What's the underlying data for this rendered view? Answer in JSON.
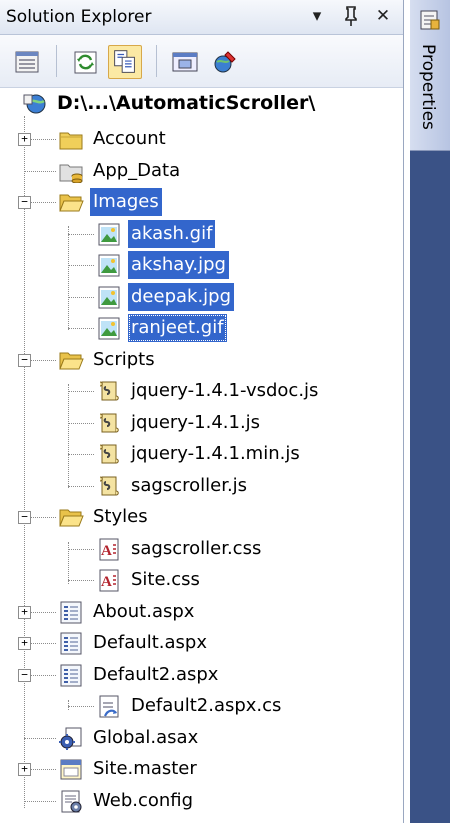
{
  "panel": {
    "title": "Solution Explorer",
    "pin": "↕",
    "close": "✕",
    "dropdown": "▾"
  },
  "side_tab": {
    "label": "Properties"
  },
  "root": {
    "label": "D:\\...\\AutomaticScroller\\"
  },
  "tree": [
    {
      "label": "Account",
      "icon": "folder-icon",
      "expander": "+"
    },
    {
      "label": "App_Data",
      "icon": "data-folder-icon",
      "expander": ""
    },
    {
      "label": "Images",
      "icon": "folder-open-icon",
      "expander": "−",
      "selected": true
    },
    {
      "label": "akash.gif",
      "icon": "image-file-icon",
      "selected": true
    },
    {
      "label": "akshay.jpg",
      "icon": "image-file-icon",
      "selected": true
    },
    {
      "label": "deepak.jpg",
      "icon": "image-file-icon",
      "selected": true
    },
    {
      "label": "ranjeet.gif",
      "icon": "image-file-icon",
      "selected": true,
      "focused": true
    },
    {
      "label": "Scripts",
      "icon": "folder-open-icon",
      "expander": "−"
    },
    {
      "label": "jquery-1.4.1-vsdoc.js",
      "icon": "script-file-icon"
    },
    {
      "label": "jquery-1.4.1.js",
      "icon": "script-file-icon"
    },
    {
      "label": "jquery-1.4.1.min.js",
      "icon": "script-file-icon"
    },
    {
      "label": "sagscroller.js",
      "icon": "script-file-icon"
    },
    {
      "label": "Styles",
      "icon": "folder-open-icon",
      "expander": "−"
    },
    {
      "label": "sagscroller.css",
      "icon": "css-file-icon"
    },
    {
      "label": "Site.css",
      "icon": "css-file-icon"
    },
    {
      "label": "About.aspx",
      "icon": "aspx-file-icon",
      "expander": "+"
    },
    {
      "label": "Default.aspx",
      "icon": "aspx-file-icon",
      "expander": "+"
    },
    {
      "label": "Default2.aspx",
      "icon": "aspx-file-icon",
      "expander": "−"
    },
    {
      "label": "Default2.aspx.cs",
      "icon": "cs-file-icon"
    },
    {
      "label": "Global.asax",
      "icon": "global-asax-icon"
    },
    {
      "label": "Site.master",
      "icon": "master-page-icon",
      "expander": "+"
    },
    {
      "label": "Web.config",
      "icon": "config-file-icon"
    }
  ],
  "colors": {
    "selection": "#3366cc",
    "side_panel": "#3a5286"
  }
}
